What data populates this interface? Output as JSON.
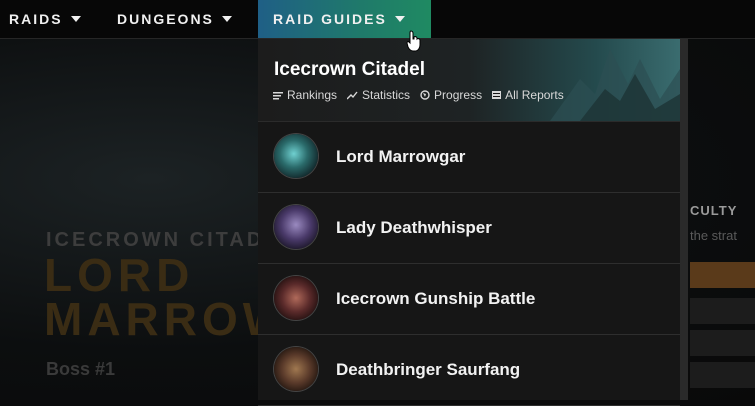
{
  "nav": {
    "items": [
      {
        "label": "RAIDS"
      },
      {
        "label": "DUNGEONS"
      },
      {
        "label": "RAID GUIDES"
      }
    ]
  },
  "dropdown": {
    "title": "Icecrown Citadel",
    "links": [
      {
        "label": "Rankings",
        "icon": "bars-icon"
      },
      {
        "label": "Statistics",
        "icon": "trend-icon"
      },
      {
        "label": "Progress",
        "icon": "globe-icon"
      },
      {
        "label": "All Reports",
        "icon": "reports-icon"
      }
    ],
    "bosses": [
      {
        "name": "Lord Marrowgar",
        "color": "#2a6a6a"
      },
      {
        "name": "Lady Deathwhisper",
        "color": "#4a3a6a"
      },
      {
        "name": "Icecrown Gunship Battle",
        "color": "#5a2a2a"
      },
      {
        "name": "Deathbringer Saurfang",
        "color": "#5a3a2a"
      }
    ]
  },
  "background": {
    "eyebrow": "ICECROWN CITADE",
    "title_line1": "LORD",
    "title_line2": "MARROW",
    "boss_number": "Boss #1",
    "panel_title": "CULTY",
    "panel_sub": "the strat"
  }
}
